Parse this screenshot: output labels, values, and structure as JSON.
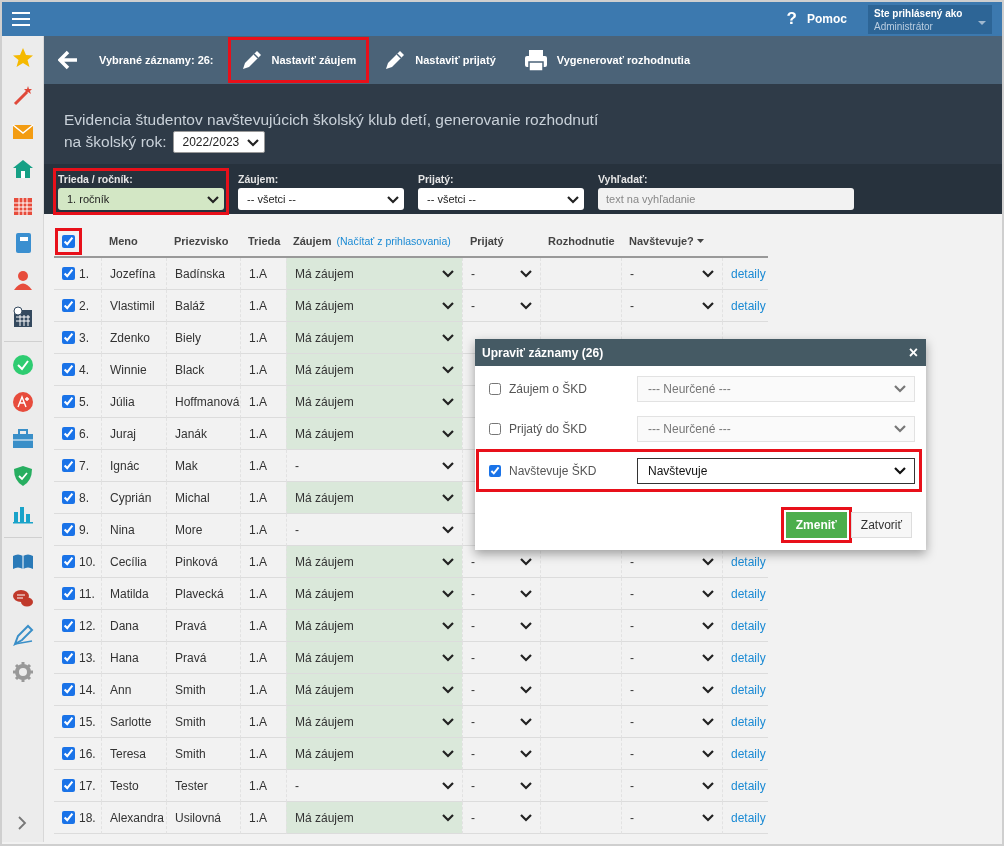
{
  "top_bar": {
    "help_icon": "?",
    "help": "Pomoc",
    "user_label": "Ste prihlásený ako",
    "user_name": "Administrátor"
  },
  "toolbar": {
    "selected_count": "Vybrané záznamy: 26:",
    "buttons": [
      {
        "label": "Nastaviť záujem",
        "kind": "pencil",
        "highlighted": true
      },
      {
        "label": "Nastaviť prijatý",
        "kind": "pencil",
        "highlighted": false
      },
      {
        "label": "Vygenerovať rozhodnutia",
        "kind": "printer",
        "highlighted": false
      }
    ]
  },
  "header": {
    "description": "Evidencia študentov navštevujúcich školský klub detí, generovanie rozhodnutí",
    "year_label": "na školský rok:",
    "year": "2022/2023"
  },
  "filters": [
    {
      "kind": "select",
      "label": "Trieda / ročník:",
      "value": "1. ročník",
      "filled": true,
      "highlighted": true
    },
    {
      "kind": "select",
      "label": "Záujem:",
      "value": "-- všetci --",
      "filled": false,
      "highlighted": false
    },
    {
      "kind": "select",
      "label": "Prijatý:",
      "value": "-- všetci --",
      "filled": false,
      "highlighted": false
    },
    {
      "kind": "search",
      "label": "Vyhľadať:",
      "placeholder": "text na vyhľadanie",
      "highlighted": false
    }
  ],
  "table": {
    "select_all": {
      "checked": true,
      "highlighted": true
    },
    "columns": [
      "Meno",
      "Priezvisko",
      "Trieda",
      "Záujem",
      "Prijatý",
      "Rozhodnutie",
      "Navštevuje?"
    ],
    "load_link": "(Načítať z prihlasovania)",
    "rows": [
      {
        "checked": true,
        "number": "1.",
        "meno": "Jozefína",
        "priezvisko": "Badínska",
        "trieda": "1.A",
        "zaujem": "Má záujem",
        "zaujem_set": true,
        "prijaty": "-",
        "navstevuje": "-",
        "detail": "detaily"
      },
      {
        "checked": true,
        "number": "2.",
        "meno": "Vlastimil",
        "priezvisko": "Baláž",
        "trieda": "1.A",
        "zaujem": "Má záujem",
        "zaujem_set": true,
        "prijaty": "-",
        "navstevuje": "-",
        "detail": "detaily"
      },
      {
        "checked": true,
        "number": "3.",
        "meno": "Zdenko",
        "priezvisko": "Biely",
        "trieda": "1.A",
        "zaujem": "Má záujem",
        "zaujem_set": true
      },
      {
        "checked": true,
        "number": "4.",
        "meno": "Winnie",
        "priezvisko": "Black",
        "trieda": "1.A",
        "zaujem": "Má záujem",
        "zaujem_set": true
      },
      {
        "checked": true,
        "number": "5.",
        "meno": "Júlia",
        "priezvisko": "Hoffmanová",
        "trieda": "1.A",
        "zaujem": "Má záujem",
        "zaujem_set": true
      },
      {
        "checked": true,
        "number": "6.",
        "meno": "Juraj",
        "priezvisko": "Janák",
        "trieda": "1.A",
        "zaujem": "Má záujem",
        "zaujem_set": true
      },
      {
        "checked": true,
        "number": "7.",
        "meno": "Ignác",
        "priezvisko": "Mak",
        "trieda": "1.A",
        "zaujem": "-",
        "zaujem_set": false
      },
      {
        "checked": true,
        "number": "8.",
        "meno": "Cyprián",
        "priezvisko": "Michal",
        "trieda": "1.A",
        "zaujem": "Má záujem",
        "zaujem_set": true
      },
      {
        "checked": true,
        "number": "9.",
        "meno": "Nina",
        "priezvisko": "More",
        "trieda": "1.A",
        "zaujem": "-",
        "zaujem_set": false
      },
      {
        "checked": true,
        "number": "10.",
        "meno": "Cecília",
        "priezvisko": "Pinková",
        "trieda": "1.A",
        "zaujem": "Má záujem",
        "zaujem_set": true,
        "prijaty": "-",
        "navstevuje": "-",
        "detail": "detaily"
      },
      {
        "checked": true,
        "number": "11.",
        "meno": "Matilda",
        "priezvisko": "Plavecká",
        "trieda": "1.A",
        "zaujem": "Má záujem",
        "zaujem_set": true,
        "prijaty": "-",
        "navstevuje": "-",
        "detail": "detaily"
      },
      {
        "checked": true,
        "number": "12.",
        "meno": "Dana",
        "priezvisko": "Pravá",
        "trieda": "1.A",
        "zaujem": "Má záujem",
        "zaujem_set": true,
        "prijaty": "-",
        "navstevuje": "-",
        "detail": "detaily"
      },
      {
        "checked": true,
        "number": "13.",
        "meno": "Hana",
        "priezvisko": "Pravá",
        "trieda": "1.A",
        "zaujem": "Má záujem",
        "zaujem_set": true,
        "prijaty": "-",
        "navstevuje": "-",
        "detail": "detaily"
      },
      {
        "checked": true,
        "number": "14.",
        "meno": "Ann",
        "priezvisko": "Smith",
        "trieda": "1.A",
        "zaujem": "Má záujem",
        "zaujem_set": true,
        "prijaty": "-",
        "navstevuje": "-",
        "detail": "detaily"
      },
      {
        "checked": true,
        "number": "15.",
        "meno": "Sarlotte",
        "priezvisko": "Smith",
        "trieda": "1.A",
        "zaujem": "Má záujem",
        "zaujem_set": true,
        "prijaty": "-",
        "navstevuje": "-",
        "detail": "detaily"
      },
      {
        "checked": true,
        "number": "16.",
        "meno": "Teresa",
        "priezvisko": "Smith",
        "trieda": "1.A",
        "zaujem": "Má záujem",
        "zaujem_set": true,
        "prijaty": "-",
        "navstevuje": "-",
        "detail": "detaily"
      },
      {
        "checked": true,
        "number": "17.",
        "meno": "Testo",
        "priezvisko": "Tester",
        "trieda": "1.A",
        "zaujem": "-",
        "zaujem_set": false,
        "prijaty": "-",
        "navstevuje": "-",
        "detail": "detaily"
      },
      {
        "checked": true,
        "number": "18.",
        "meno": "Alexandra",
        "priezvisko": "Usilovná",
        "trieda": "1.A",
        "zaujem": "Má záujem",
        "zaujem_set": true,
        "prijaty": "-",
        "navstevuje": "-",
        "detail": "detaily"
      }
    ]
  },
  "dialog": {
    "title": "Upraviť záznamy (26)",
    "close": "×",
    "fields": [
      {
        "label": "Záujem o ŠKD",
        "checked": false,
        "value": "--- Neurčené ---",
        "highlighted": false
      },
      {
        "label": "Prijatý do ŠKD",
        "checked": false,
        "value": "--- Neurčené ---",
        "highlighted": false
      },
      {
        "label": "Navštevuje ŠKD",
        "checked": true,
        "value": "Navštevuje",
        "highlighted": true
      }
    ],
    "buttons": [
      {
        "label": "Zmeniť",
        "kind": "primary",
        "highlighted": true
      },
      {
        "label": "Zatvoriť",
        "kind": "secondary",
        "highlighted": false
      }
    ]
  }
}
